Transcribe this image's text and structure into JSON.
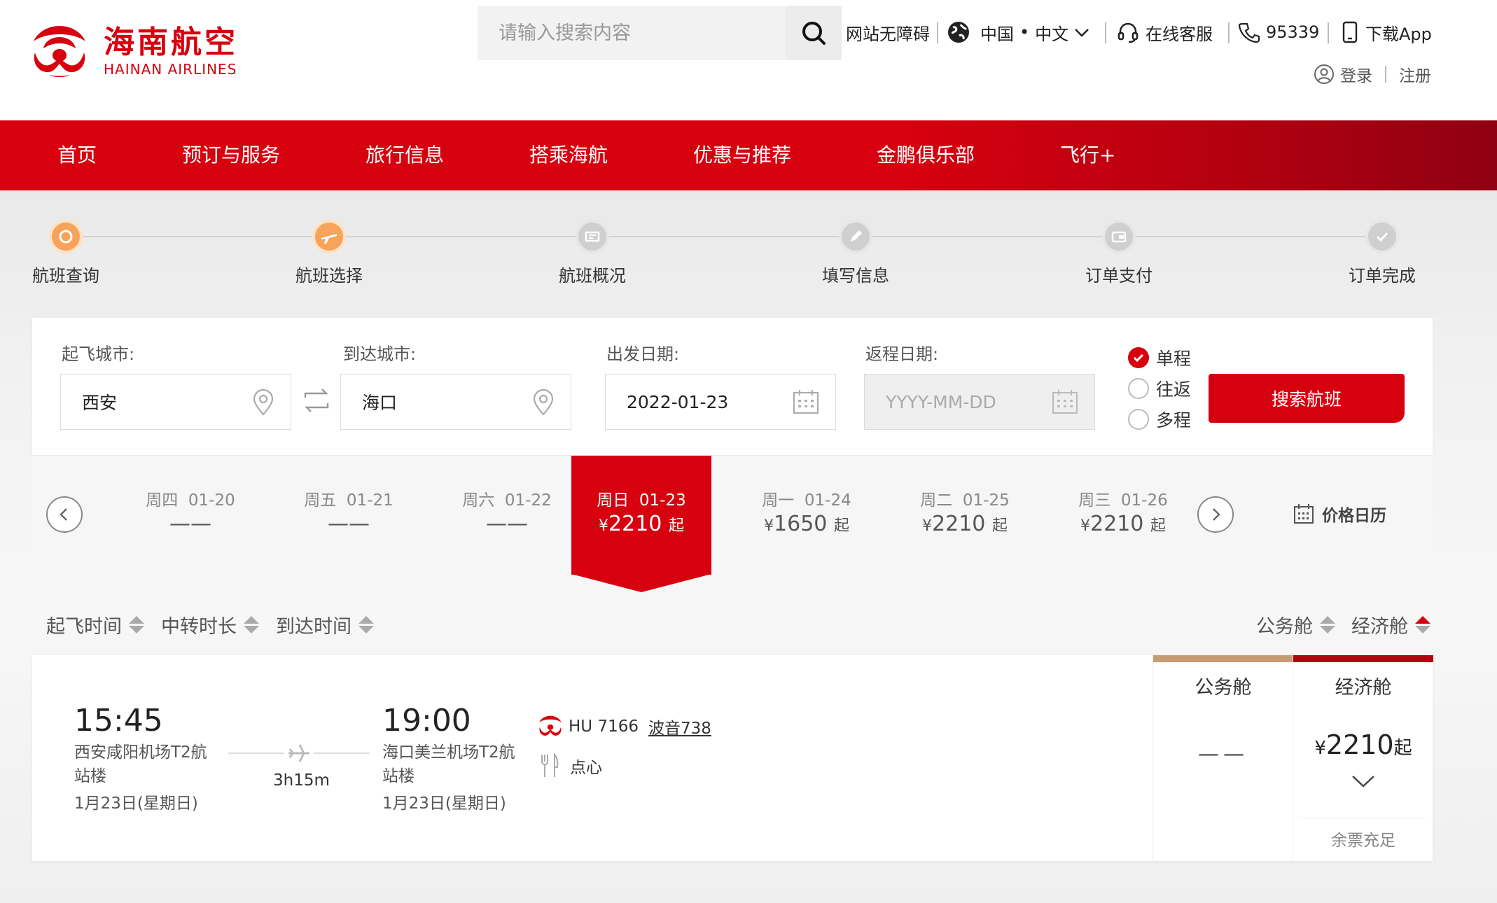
{
  "brand": {
    "cn": "海南航空",
    "en": "HAINAN AIRLINES",
    "color": "#d7000f"
  },
  "search": {
    "placeholder": "请输入搜索内容"
  },
  "utility": {
    "accessibility": "网站无障碍",
    "region": "中国",
    "language": "中文",
    "service": "在线客服",
    "phone": "95339",
    "app": "下载App",
    "login": "登录",
    "register": "注册"
  },
  "nav": [
    "首页",
    "预订与服务",
    "旅行信息",
    "搭乘海航",
    "优惠与推荐",
    "金鹏俱乐部",
    "飞行+"
  ],
  "steps": [
    {
      "label": "航班查询",
      "state": "done"
    },
    {
      "label": "航班选择",
      "state": "done"
    },
    {
      "label": "航班概况",
      "state": "todo"
    },
    {
      "label": "填写信息",
      "state": "todo"
    },
    {
      "label": "订单支付",
      "state": "todo"
    },
    {
      "label": "订单完成",
      "state": "todo"
    }
  ],
  "form": {
    "from_label": "起飞城市:",
    "from_value": "西安",
    "to_label": "到达城市:",
    "to_value": "海口",
    "depart_label": "出发日期:",
    "depart_value": "2022-01-23",
    "return_label": "返程日期:",
    "return_placeholder": "YYYY-MM-DD",
    "trip_one_way": "单程",
    "trip_round": "往返",
    "trip_multi": "多程",
    "search_button": "搜索航班"
  },
  "dates": [
    {
      "day": "周四",
      "date": "01-20",
      "price": "——",
      "active": false
    },
    {
      "day": "周五",
      "date": "01-21",
      "price": "——",
      "active": false
    },
    {
      "day": "周六",
      "date": "01-22",
      "price": "——",
      "active": false
    },
    {
      "day": "周日",
      "date": "01-23",
      "price": "2210",
      "active": true
    },
    {
      "day": "周一",
      "date": "01-24",
      "price": "1650",
      "active": false
    },
    {
      "day": "周二",
      "date": "01-25",
      "price": "2210",
      "active": false
    },
    {
      "day": "周三",
      "date": "01-26",
      "price": "2210",
      "active": false
    }
  ],
  "currency": "¥",
  "price_suffix": "起",
  "price_calendar": "价格日历",
  "sort": {
    "depart_time": "起飞时间",
    "transfer": "中转时长",
    "arrive_time": "到达时间",
    "business": "公务舱",
    "economy": "经济舱"
  },
  "flight": {
    "depart_time": "15:45",
    "depart_airport": "西安咸阳机场T2航站楼",
    "depart_date": "1月23日(星期日)",
    "duration": "3h15m",
    "arrive_time": "19:00",
    "arrive_airport": "海口美兰机场T2航站楼",
    "arrive_date": "1月23日(星期日)",
    "airline_code": "HU 7166",
    "aircraft": "波音738",
    "meal": "点心",
    "business_title": "公务舱",
    "business_price": "——",
    "economy_title": "经济舱",
    "economy_price": "2210",
    "economy_stock": "余票充足"
  },
  "colors": {
    "business_bar": "#c99b73",
    "economy_bar": "#b5000e",
    "step_done": "#f7a35b"
  }
}
